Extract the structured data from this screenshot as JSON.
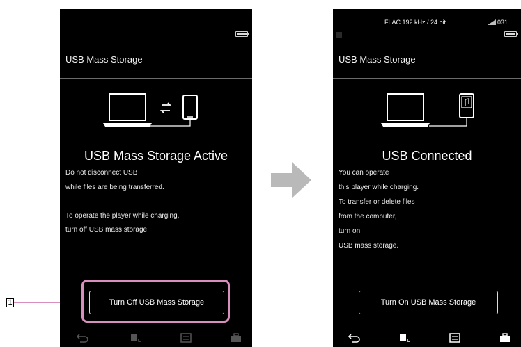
{
  "left_screen": {
    "title": "USB Mass Storage",
    "status_heading": "USB Mass Storage Active",
    "message_lines": [
      "Do not disconnect USB",
      "while files are being transferred.",
      "",
      "To operate the player while charging,",
      "turn off USB mass storage."
    ],
    "action_button_label": "Turn Off USB Mass Storage",
    "nav_icons": [
      "back-icon",
      "now-playing-icon",
      "library-icon",
      "options-icon"
    ]
  },
  "right_screen": {
    "top_status": "FLAC 192 kHz / 24 bit",
    "signal_text": "031",
    "title": "USB Mass Storage",
    "status_heading": "USB Connected",
    "message_lines": [
      "You can operate",
      "this player while charging.",
      "To transfer or delete files",
      "from the computer,",
      "turn on",
      "USB mass storage."
    ],
    "action_button_label": "Turn On USB Mass Storage",
    "nav_icons": [
      "back-icon",
      "now-playing-icon",
      "library-icon",
      "options-icon"
    ]
  },
  "callout": {
    "number": "1"
  },
  "colors": {
    "screen_bg": "#000000",
    "highlight": "#d98fbd",
    "arrow": "#b9b9b9"
  }
}
